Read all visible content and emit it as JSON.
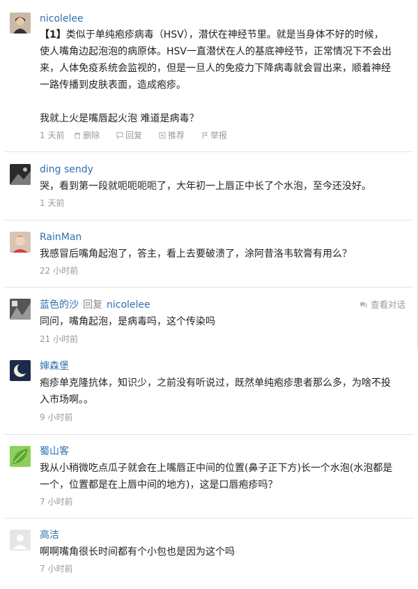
{
  "comments": [
    {
      "author": "nicolelee",
      "tag": "【1】",
      "body_lines": [
        "类似于单纯疱疹病毒（HSV），潜伏在神经节里。就是当身体不好的时候，",
        "使人嘴角边起泡泡的病原体。HSV一直潜伏在人的基底神经节，正常情况下不会出",
        "来，人体免疫系统会监视的，但是一旦人的免疫力下降病毒就会冒出来，顺着神经",
        "一路传播到皮肤表面，造成疱疹。"
      ],
      "follow_up": "我就上火是嘴唇起火泡 难道是病毒？",
      "time": "1 天前",
      "actions": {
        "delete": "删除",
        "reply": "回复",
        "recommend": "推荐",
        "report": "举报"
      }
    },
    {
      "author": "ding sendy",
      "body_lines": [
        "哭，看到第一段就呃呃呃呃了，大年初一上唇正中长了个水泡，至今还没好。"
      ],
      "time": "1 天前"
    },
    {
      "author": "RainMan",
      "body_lines": [
        "我感冒后嘴角起泡了，答主，看上去要破溃了，涂阿昔洛韦软膏有用么？"
      ],
      "time": "22 小时前"
    },
    {
      "author": "蓝色的沙",
      "reply_word": "回复",
      "reply_to": "nicolelee",
      "view_dialog": "查看对话",
      "body_lines": [
        "同问，嘴角起泡，是病毒吗，这个传染吗"
      ],
      "time": "21 小时前"
    },
    {
      "author": "婶森堡",
      "body_lines": [
        "疱疹单克隆抗体，知识少，之前没有听说过，既然单纯疱疹患者那么多，为啥不投",
        "入市场啊。。"
      ],
      "time": "9 小时前"
    },
    {
      "author": "蜀山客",
      "body_lines": [
        "我从小稍微吃点瓜子就会在上嘴唇正中间的位置(鼻子正下方)长一个水泡(水泡都是",
        "一个，位置都是在上唇中间的地方)，这是口唇疱疹吗？"
      ],
      "time": "7 小时前"
    },
    {
      "author": "高洁",
      "body_lines": [
        "啊啊嘴角很长时间都有个小包也是因为这个吗"
      ],
      "time": "7 小时前"
    }
  ],
  "colors": {
    "author": "#2f6fb0",
    "time": "#999999",
    "text": "#222222"
  }
}
